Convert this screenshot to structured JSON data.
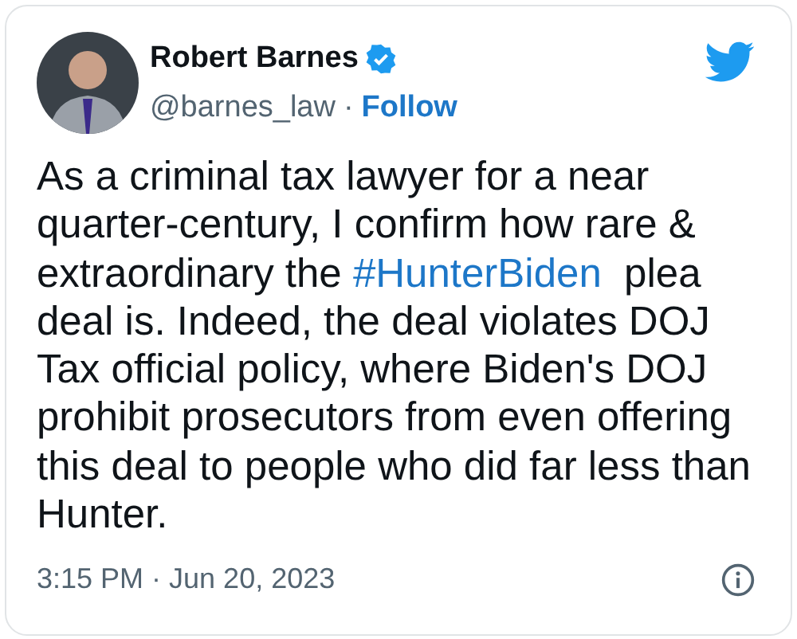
{
  "author": {
    "name": "Robert Barnes",
    "verified": true,
    "handle": "@barnes_law",
    "separator": "·",
    "follow": "Follow"
  },
  "tweet": {
    "text_before": "As a criminal tax lawyer for a near quarter-century, I confirm how rare & extraordinary the ",
    "hashtag": "#HunterBiden",
    "text_after": "  plea deal is. Indeed, the deal violates DOJ Tax official policy, where Biden's DOJ prohibit prosecutors from even offering this deal to people who did far less than Hunter."
  },
  "timestamp": "3:15 PM · Jun 20, 2023"
}
